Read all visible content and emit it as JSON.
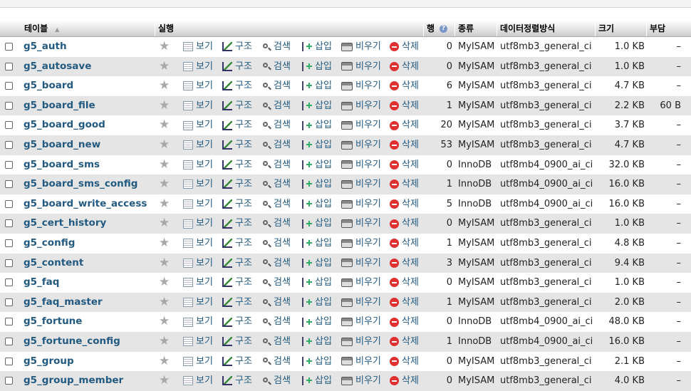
{
  "header": {
    "table": "테이블",
    "action": "실행",
    "rows": "행",
    "type": "종류",
    "collation": "데이터정렬방식",
    "size": "크기",
    "overhead": "부담"
  },
  "actions": {
    "browse": "보기",
    "structure": "구조",
    "search": "검색",
    "insert": "삽입",
    "empty": "비우기",
    "drop": "삭제"
  },
  "rows": [
    {
      "name": "g5_auth",
      "rows": "0",
      "type": "MyISAM",
      "collation": "utf8mb3_general_ci",
      "size": "1.0 KB",
      "overhead": "–"
    },
    {
      "name": "g5_autosave",
      "rows": "0",
      "type": "MyISAM",
      "collation": "utf8mb3_general_ci",
      "size": "1.0 KB",
      "overhead": "–"
    },
    {
      "name": "g5_board",
      "rows": "6",
      "type": "MyISAM",
      "collation": "utf8mb3_general_ci",
      "size": "4.7 KB",
      "overhead": "–"
    },
    {
      "name": "g5_board_file",
      "rows": "1",
      "type": "MyISAM",
      "collation": "utf8mb3_general_ci",
      "size": "2.2 KB",
      "overhead": "60 B"
    },
    {
      "name": "g5_board_good",
      "rows": "20",
      "type": "MyISAM",
      "collation": "utf8mb3_general_ci",
      "size": "3.7 KB",
      "overhead": "–"
    },
    {
      "name": "g5_board_new",
      "rows": "53",
      "type": "MyISAM",
      "collation": "utf8mb3_general_ci",
      "size": "4.7 KB",
      "overhead": "–"
    },
    {
      "name": "g5_board_sms",
      "rows": "0",
      "type": "InnoDB",
      "collation": "utf8mb4_0900_ai_ci",
      "size": "32.0 KB",
      "overhead": "–"
    },
    {
      "name": "g5_board_sms_config",
      "rows": "1",
      "type": "InnoDB",
      "collation": "utf8mb4_0900_ai_ci",
      "size": "16.0 KB",
      "overhead": "–"
    },
    {
      "name": "g5_board_write_access",
      "rows": "5",
      "type": "InnoDB",
      "collation": "utf8mb4_0900_ai_ci",
      "size": "16.0 KB",
      "overhead": "–"
    },
    {
      "name": "g5_cert_history",
      "rows": "0",
      "type": "MyISAM",
      "collation": "utf8mb3_general_ci",
      "size": "1.0 KB",
      "overhead": "–"
    },
    {
      "name": "g5_config",
      "rows": "1",
      "type": "MyISAM",
      "collation": "utf8mb3_general_ci",
      "size": "4.8 KB",
      "overhead": "–"
    },
    {
      "name": "g5_content",
      "rows": "3",
      "type": "MyISAM",
      "collation": "utf8mb3_general_ci",
      "size": "9.4 KB",
      "overhead": "–"
    },
    {
      "name": "g5_faq",
      "rows": "0",
      "type": "MyISAM",
      "collation": "utf8mb3_general_ci",
      "size": "1.0 KB",
      "overhead": "–"
    },
    {
      "name": "g5_faq_master",
      "rows": "1",
      "type": "MyISAM",
      "collation": "utf8mb3_general_ci",
      "size": "2.0 KB",
      "overhead": "–"
    },
    {
      "name": "g5_fortune",
      "rows": "0",
      "type": "InnoDB",
      "collation": "utf8mb4_0900_ai_ci",
      "size": "48.0 KB",
      "overhead": "–"
    },
    {
      "name": "g5_fortune_config",
      "rows": "1",
      "type": "InnoDB",
      "collation": "utf8mb4_0900_ai_ci",
      "size": "16.0 KB",
      "overhead": "–"
    },
    {
      "name": "g5_group",
      "rows": "0",
      "type": "MyISAM",
      "collation": "utf8mb3_general_ci",
      "size": "2.1 KB",
      "overhead": "–"
    },
    {
      "name": "g5_group_member",
      "rows": "0",
      "type": "MyISAM",
      "collation": "utf8mb3_general_ci",
      "size": "4.0 KB",
      "overhead": "–"
    }
  ]
}
